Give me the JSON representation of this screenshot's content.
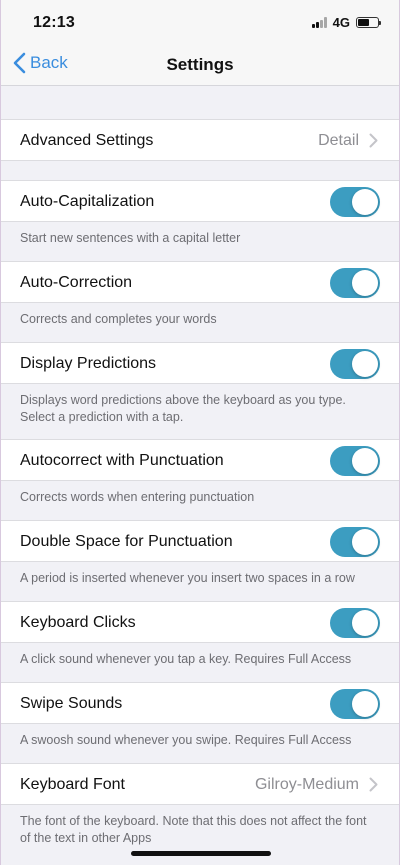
{
  "status": {
    "time": "12:13",
    "network": "4G"
  },
  "nav": {
    "back_label": "Back",
    "title": "Settings"
  },
  "advanced": {
    "label": "Advanced Settings",
    "detail": "Detail"
  },
  "toggles": [
    {
      "label": "Auto-Capitalization",
      "on": true,
      "note": "Start new sentences with a capital letter"
    },
    {
      "label": "Auto-Correction",
      "on": true,
      "note": "Corrects and completes your words"
    },
    {
      "label": "Display Predictions",
      "on": true,
      "note": "Displays word predictions above the keyboard as you type. Select a prediction with a tap."
    },
    {
      "label": "Autocorrect with Punctuation",
      "on": true,
      "note": "Corrects words when entering punctuation"
    },
    {
      "label": "Double Space for Punctuation",
      "on": true,
      "note": "A period is inserted whenever you insert two spaces in a row"
    },
    {
      "label": "Keyboard Clicks",
      "on": true,
      "note": "A click sound whenever you tap a key. Requires Full Access"
    },
    {
      "label": "Swipe Sounds",
      "on": true,
      "note": "A swoosh sound whenever you swipe. Requires Full Access"
    }
  ],
  "font": {
    "label": "Keyboard Font",
    "detail": "Gilroy-Medium",
    "note": "The font of the keyboard. Note that this does not affect the font of the text in other Apps"
  },
  "colors": {
    "accent": "#3a8dde",
    "toggle_on": "#3c9dc1",
    "background": "#f1f1f6"
  }
}
